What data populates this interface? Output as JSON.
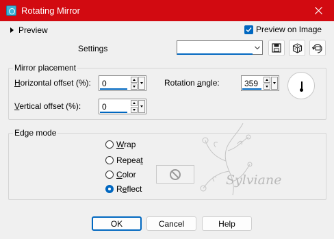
{
  "window": {
    "title": "Rotating Mirror",
    "app_icon": "rotating-mirror-app-icon",
    "close_icon": "close-icon"
  },
  "preview": {
    "toggle_label": "Preview",
    "preview_on_image_label": "Preview on Image",
    "preview_on_image_checked": true
  },
  "settings": {
    "label": "Settings",
    "combo_value": "",
    "buttons": [
      {
        "icon": "save-preset-icon"
      },
      {
        "icon": "randomize-dice-icon"
      },
      {
        "icon": "reset-defaults-icon"
      }
    ]
  },
  "mirror_placement": {
    "group_label": "Mirror placement",
    "horizontal_offset": {
      "label_pre": "",
      "label_key": "H",
      "label_post": "orizontal offset (%):",
      "value": "0"
    },
    "vertical_offset": {
      "label_pre": "",
      "label_key": "V",
      "label_post": "ertical offset (%):",
      "value": "0"
    },
    "rotation_angle": {
      "label_pre": "Rotation ",
      "label_key": "a",
      "label_post": "ngle:",
      "value": "359"
    },
    "dial_icon": "angle-dial-icon"
  },
  "edge_mode": {
    "group_label": "Edge mode",
    "options": [
      {
        "pre": "",
        "key": "W",
        "post": "rap",
        "checked": false
      },
      {
        "pre": "Repea",
        "key": "t",
        "post": "",
        "checked": false
      },
      {
        "pre": "",
        "key": "C",
        "post": "olor",
        "checked": false
      },
      {
        "pre": "R",
        "key": "e",
        "post": "flect",
        "checked": true
      }
    ],
    "color_swatch_icon": "disabled-no-icon"
  },
  "watermark": {
    "text": "Sylviane"
  },
  "buttons": {
    "ok": "OK",
    "cancel": "Cancel",
    "help": "Help"
  },
  "colors": {
    "titlebar": "#d20a11",
    "accent": "#0067c0",
    "background": "#f0f0f0"
  }
}
